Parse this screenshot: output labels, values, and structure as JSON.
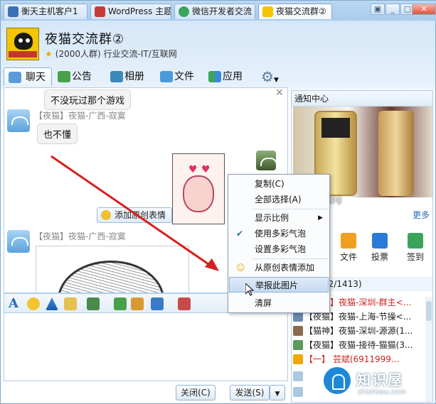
{
  "tabs": [
    {
      "label": "衡天主机客户1"
    },
    {
      "label": "WordPress 主题"
    },
    {
      "label": "微信开发者交流"
    },
    {
      "label": "夜猫交流群②"
    }
  ],
  "header": {
    "title": "夜猫交流群②",
    "subtitle": "(2000人群) 行业交流-IT/互联网"
  },
  "toolbar": {
    "chat": "聊天",
    "notice": "公告",
    "album": "相册",
    "files": "文件",
    "apps": "应用"
  },
  "chat": {
    "msg1": "不没玩过那个游戏",
    "sender1": "【夜猫】夜猫-广西-寂寞",
    "msg2": "也不懂",
    "add_face": "添加原创表情",
    "sender2": "【夜猫】夜猫-广西-寂寞"
  },
  "context_menu": {
    "items": [
      "复制(C)",
      "全部选择(A)",
      "显示比例",
      "使用多彩气泡",
      "设置多彩气泡",
      "从原创表情添加",
      "举报此图片",
      "清屏"
    ]
  },
  "buttons": {
    "close": "关闭(C)",
    "send": "发送(S)"
  },
  "right_panel": {
    "title": "通知中心",
    "image_label": "jpg",
    "more": "更多",
    "apps": [
      "文件",
      "投票",
      "签到"
    ],
    "member_count": "92/1413)",
    "members": [
      "【猫仙】夜猫-深圳-群主<...",
      "【夜猫】夜猫-上海-节操<...",
      "【猫神】夜猫-深圳-源源(1...",
      "【夜猫】夜猫-接待-猫猫(3...",
      "【一】 芸斌(6911999..."
    ]
  },
  "watermark": {
    "name": "知识屋",
    "url": "zhishiwu.com"
  }
}
